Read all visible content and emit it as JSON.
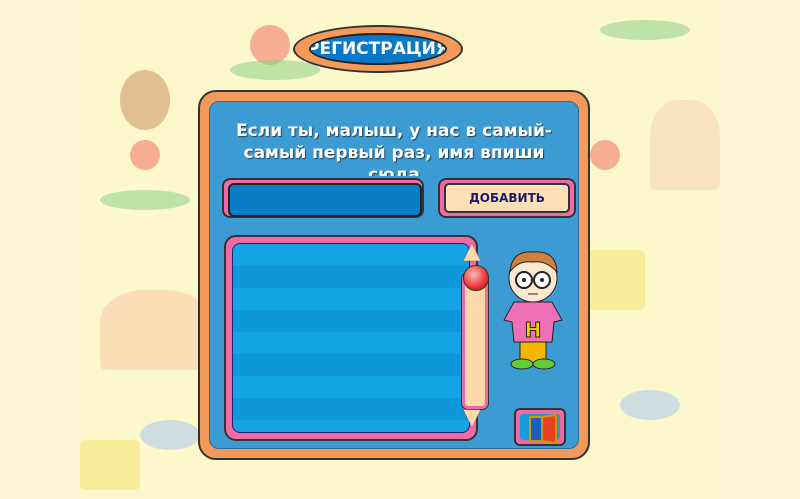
{
  "title": "РЕГИСТРАЦИЯ",
  "prompt": "Если ты, малыш, у нас в самый-самый первый раз, имя впиши сюда",
  "name_input": {
    "value": "",
    "placeholder": ""
  },
  "add_button": "ДОБАВИТЬ",
  "user_list": [],
  "colors": {
    "panel_border": "#f39a5a",
    "panel_bg": "#3d9bd3",
    "accent_pink": "#f06aa8",
    "button_bg": "#fde0b8",
    "title_bg": "#0a78c8"
  },
  "icons": {
    "character": "boy-with-glasses",
    "exit": "door-icon",
    "scroll_up": "triangle-up",
    "scroll_down": "triangle-down"
  }
}
